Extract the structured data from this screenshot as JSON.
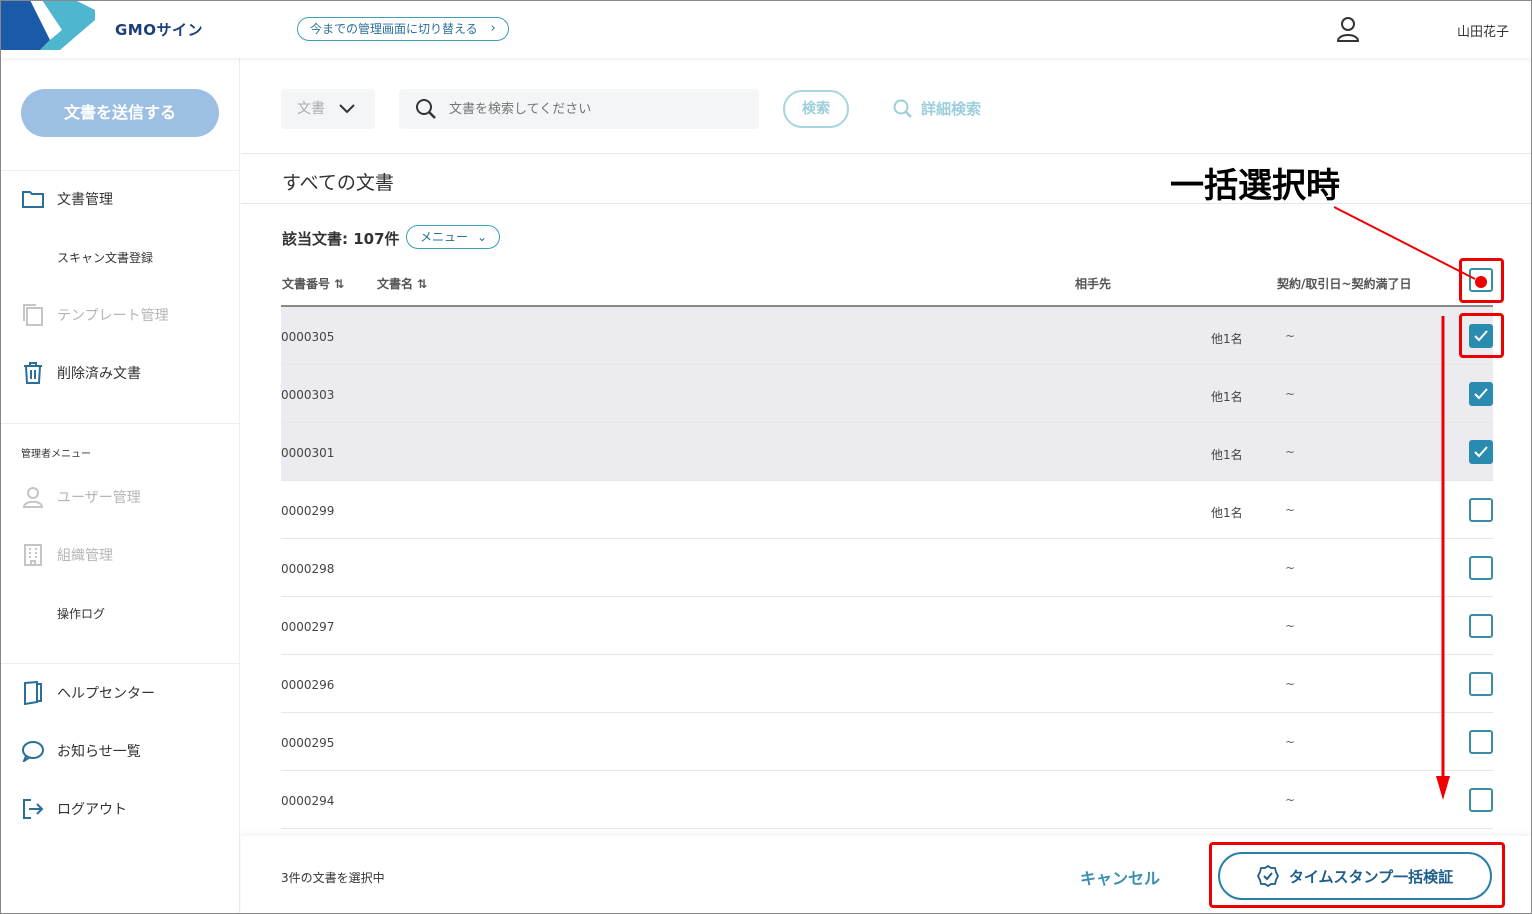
{
  "header": {
    "logo_text": "GMOサイン",
    "switch_label": "今までの管理画面に切り替える",
    "user_name": "山田花子"
  },
  "sidebar": {
    "send_button": "文書を送信する",
    "items": [
      {
        "label": "文書管理",
        "icon": "folder-icon"
      },
      {
        "label": "スキャン文書登録"
      },
      {
        "label": "テンプレート管理",
        "icon": "template-icon"
      },
      {
        "label": "削除済み文書",
        "icon": "trash-icon"
      }
    ],
    "admin_section": "管理者メニュー",
    "admin_items": [
      {
        "label": "ユーザー管理",
        "icon": "user-icon"
      },
      {
        "label": "組織管理",
        "icon": "building-icon"
      },
      {
        "label": "操作ログ"
      }
    ],
    "bottom_items": [
      {
        "label": "ヘルプセンター",
        "icon": "help-icon"
      },
      {
        "label": "お知らせ一覧",
        "icon": "chat-icon"
      },
      {
        "label": "ログアウト",
        "icon": "logout-icon"
      }
    ]
  },
  "search": {
    "doc_type": "文書",
    "placeholder": "文書を検索してください",
    "search_button": "検索",
    "advanced": "詳細検索"
  },
  "content": {
    "title": "すべての文書",
    "count_label": "該当文書: 107件",
    "menu_button": "メニュー",
    "columns": {
      "number": "文書番号",
      "name": "文書名",
      "party": "相手先",
      "date": "契約/取引日~契約満了日"
    },
    "rows": [
      {
        "number": "0000305",
        "party": "他1名",
        "date": "~",
        "checked": true
      },
      {
        "number": "0000303",
        "party": "他1名",
        "date": "~",
        "checked": true
      },
      {
        "number": "0000301",
        "party": "他1名",
        "date": "~",
        "checked": true
      },
      {
        "number": "0000299",
        "party": "他1名",
        "date": "~",
        "checked": false
      },
      {
        "number": "0000298",
        "party": "",
        "date": "~",
        "checked": false
      },
      {
        "number": "0000297",
        "party": "",
        "date": "~",
        "checked": false
      },
      {
        "number": "0000296",
        "party": "",
        "date": "~",
        "checked": false
      },
      {
        "number": "0000295",
        "party": "",
        "date": "~",
        "checked": false
      },
      {
        "number": "0000294",
        "party": "",
        "date": "~",
        "checked": false
      }
    ]
  },
  "footer": {
    "selected_count": "3件の文書を選択中",
    "cancel": "キャンセル",
    "timestamp_verify": "タイムスタンプ一括検証"
  },
  "annotation": {
    "label": "一括選択時",
    "color": "#e00000"
  }
}
